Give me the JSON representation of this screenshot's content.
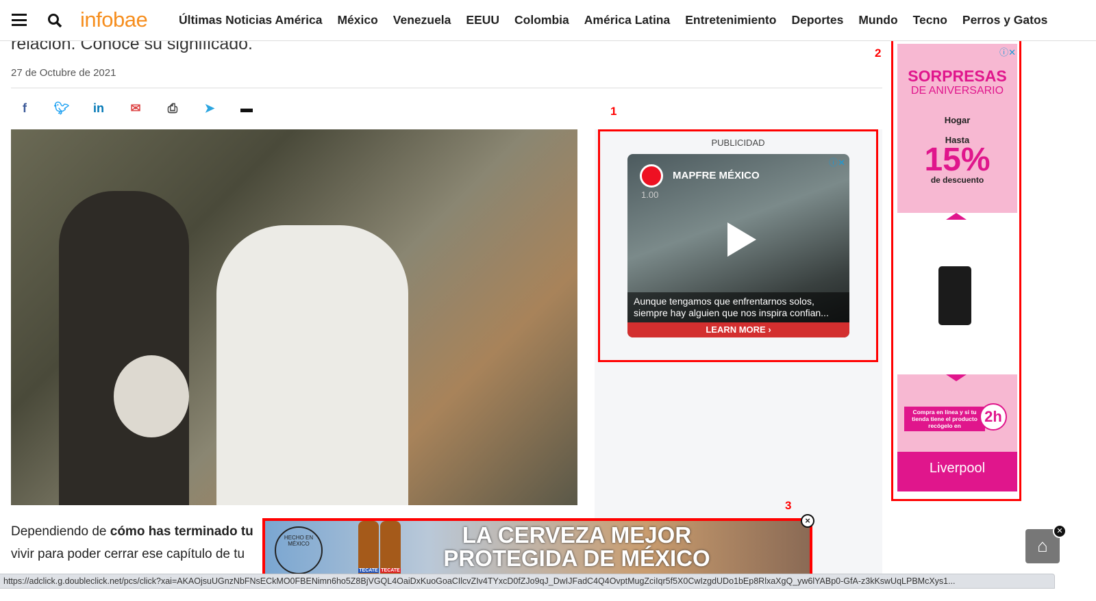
{
  "nav": {
    "logo": "infobae",
    "items": [
      "Últimas Noticias América",
      "México",
      "Venezuela",
      "EEUU",
      "Colombia",
      "América Latina",
      "Entretenimiento",
      "Deportes",
      "Mundo",
      "Tecno",
      "Perros y Gatos"
    ]
  },
  "article": {
    "title": "relación. Conoce su significado.",
    "date": "27 de Octubre de 2021",
    "share_icons": [
      "facebook-icon",
      "twitter-icon",
      "linkedin-icon",
      "email-icon",
      "print-icon",
      "telegram-icon",
      "comments-icon"
    ],
    "para1_start": "Dependiendo de ",
    "para1_bold": "cómo has terminado tu",
    "para2": "vivir para poder cerrar ese capítulo de tu"
  },
  "annotations": [
    "1",
    "2",
    "3"
  ],
  "ad1": {
    "label": "PUBLICIDAD",
    "advertiser": "MAPFRE MÉXICO",
    "speed": "1.00",
    "caption": "Aunque tengamos que enfrentarnos solos, siempre hay alguien que nos inspira confian...",
    "cta": "LEARN MORE"
  },
  "ad2": {
    "headline": "SORPRESAS",
    "subhead": "DE ANIVERSARIO",
    "category": "Hogar",
    "hasta": "Hasta",
    "discount": "15%",
    "desc": "de descuento",
    "compra": "Compra en línea y si tu tienda tiene el producto recógelo en",
    "time": "2h",
    "brand": "Liverpool"
  },
  "ad3": {
    "seal": "HECHO EN MÉXICO",
    "bottle": "TECATE",
    "line1": "LA CERVEZA MEJOR",
    "line2": "PROTEGIDA DE MÉXICO"
  },
  "status_url": "https://adclick.g.doubleclick.net/pcs/click?xai=AKAOjsuUGnzNbFNsECkMO0FBENimn6ho5Z8BjVGQL4OaiDxKuoGoaCIlcvZIv4TYxcD0fZJo9qJ_DwIJFadC4Q4OvptMugZciIqr5f5X0CwIzgdUDo1bEp8RlxaXgQ_yw6lYABp0-GfA-z3kKswUqLPBMcXys1..."
}
